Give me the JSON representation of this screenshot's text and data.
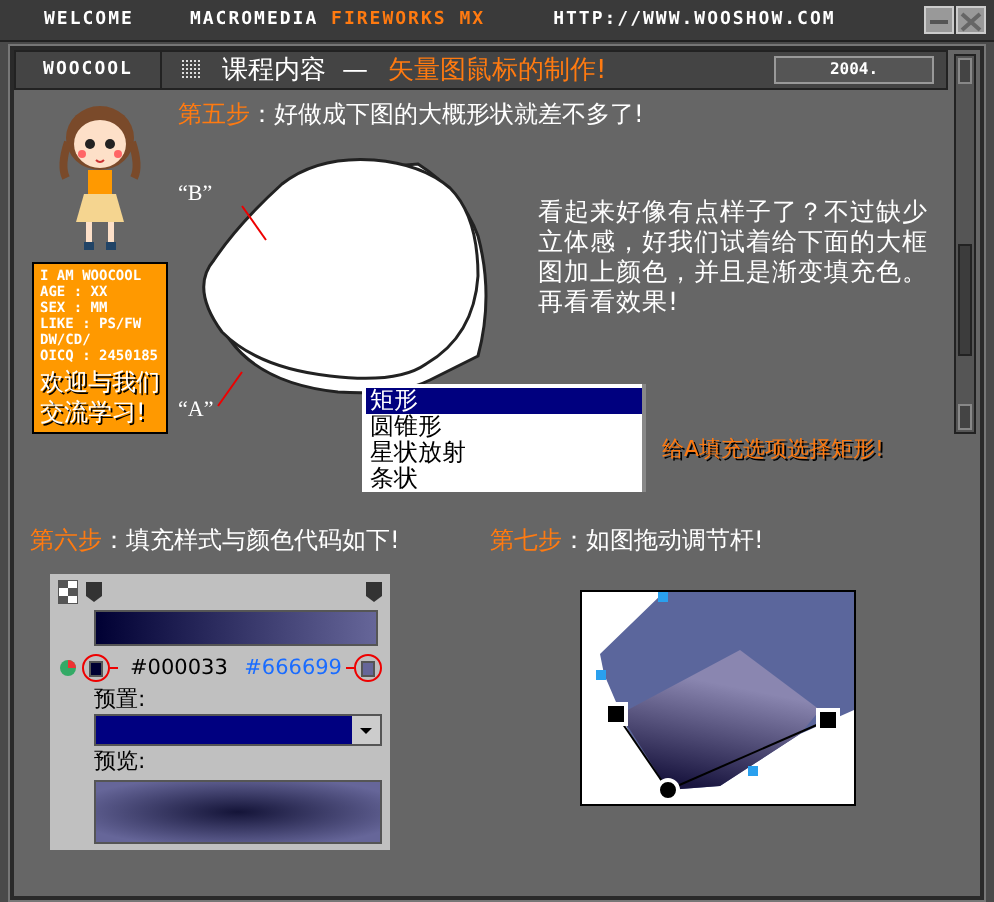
{
  "top_bar": {
    "welcome": "WELCOME",
    "product_prefix": "MACROMEDIA",
    "product_name": "FIREWORKS MX",
    "url": "HTTP://WWW.WOOSHOW.COM"
  },
  "header": {
    "logo": "WOOCOOL",
    "section": "课程内容",
    "dash": "—",
    "title": "矢量图鼠标的制作!",
    "year": "2004."
  },
  "profile": {
    "lines": [
      "I AM WOOCOOL",
      "AGE : XX",
      "SEX : MM",
      "LIKE : PS/FW",
      "DW/CD/",
      "OICQ : 2450185"
    ],
    "greeting": "欢迎与我们交流学习!"
  },
  "step5": {
    "label": "第五步",
    "text": "：好做成下图的大概形状就差不多了!",
    "labels": [
      "“B”",
      "“A”"
    ],
    "paragraph": "看起来好像有点样子了？不过缺少立体感，好我们试着给下面的大框图加上颜色，并且是渐变填充色。再看看效果!",
    "fill_options": [
      {
        "label": "矩形",
        "selected": true
      },
      {
        "label": "圆锥形",
        "selected": false
      },
      {
        "label": "星状放射",
        "selected": false
      },
      {
        "label": "条状",
        "selected": false
      }
    ],
    "note": "给A填充选项选择矩形!"
  },
  "step6": {
    "label": "第六步",
    "text": "：填充样式与颜色代码如下!",
    "start_color": "#000033",
    "end_color": "#666699",
    "preset_label": "预置:",
    "preview_label": "预览:"
  },
  "step7": {
    "label": "第七步",
    "text": "：如图拖动调节杆!"
  }
}
